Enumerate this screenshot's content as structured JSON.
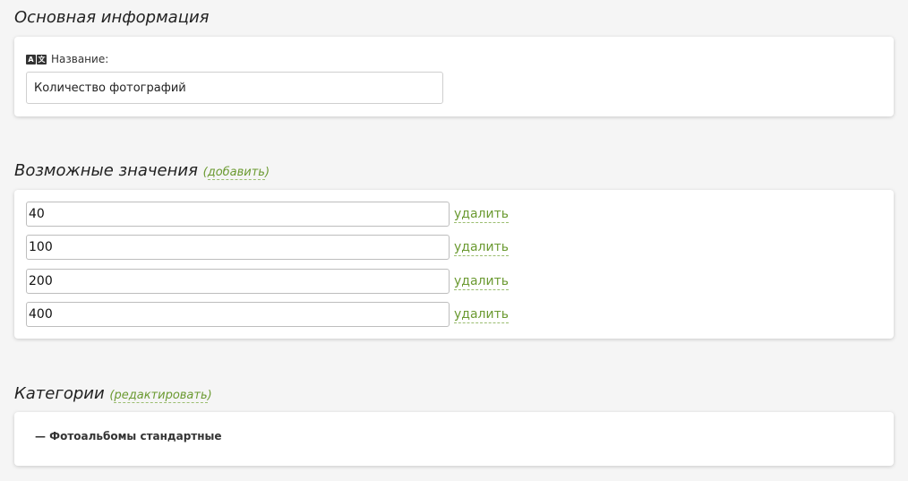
{
  "basic_info": {
    "title": "Основная информация",
    "name_label": "Название:",
    "name_value": "Количество фотографий",
    "lang_icon": "translate-icon"
  },
  "values_section": {
    "title": "Возможные значения",
    "add_link": "добавить",
    "delete_label": "удалить",
    "values": [
      "40",
      "100",
      "200",
      "400"
    ]
  },
  "categories_section": {
    "title": "Категории",
    "edit_link": "редактировать",
    "items": [
      "— Фотоальбомы стандартные"
    ]
  },
  "colors": {
    "accent": "#6b9a31",
    "background": "#f5f5f5",
    "card": "#ffffff"
  }
}
